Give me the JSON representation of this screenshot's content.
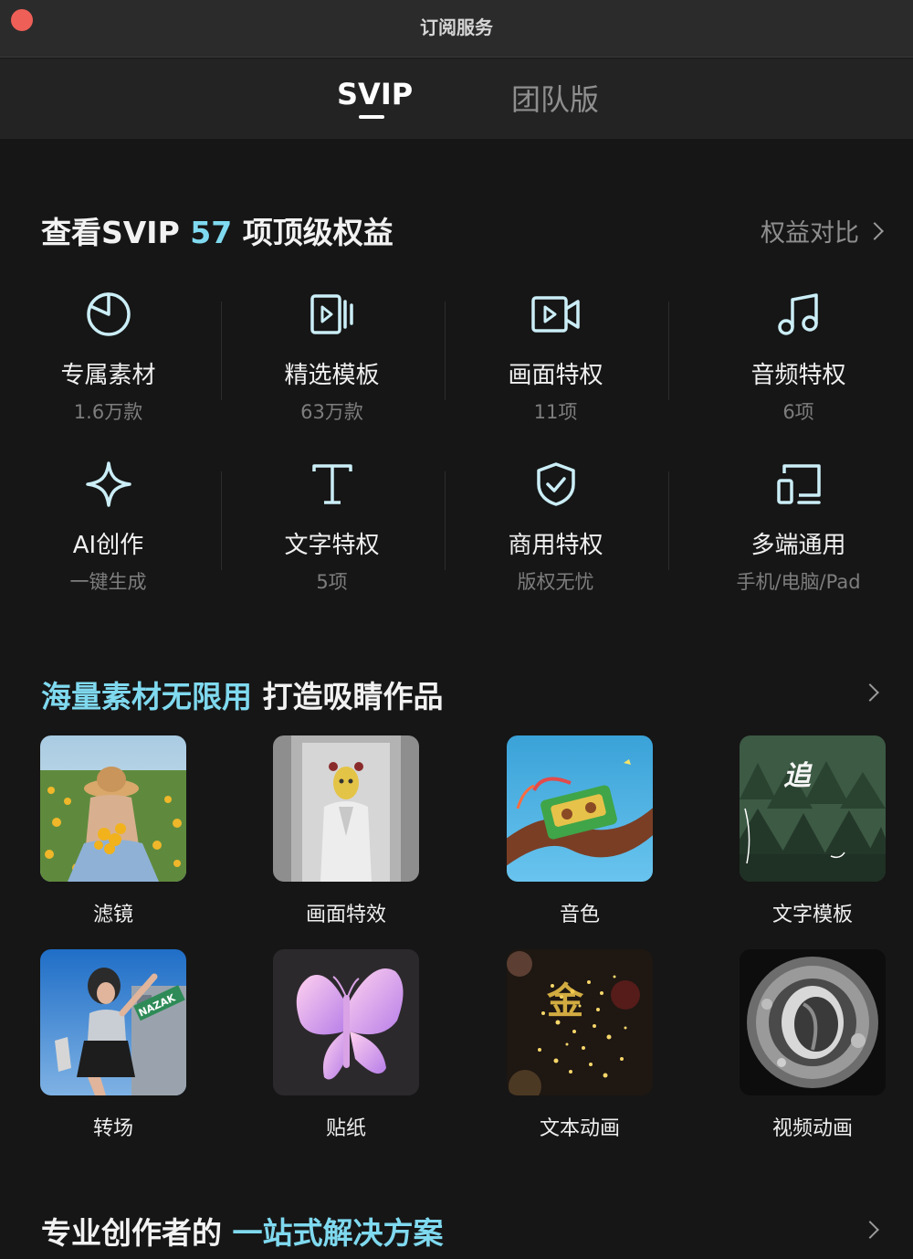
{
  "window": {
    "title": "订阅服务"
  },
  "tabs": [
    {
      "label": "SVIP",
      "active": true
    },
    {
      "label": "团队版",
      "active": false
    }
  ],
  "benefits_section": {
    "title_prefix": "查看SVIP ",
    "count": "57",
    "title_suffix": " 项顶级权益",
    "compare_link": "权益对比"
  },
  "benefits": [
    {
      "name": "专属素材",
      "sub": "1.6万款",
      "icon": "pie-icon"
    },
    {
      "name": "精选模板",
      "sub": "63万款",
      "icon": "template-icon"
    },
    {
      "name": "画面特权",
      "sub": "11项",
      "icon": "video-icon"
    },
    {
      "name": "音频特权",
      "sub": "6项",
      "icon": "music-note-icon"
    },
    {
      "name": "AI创作",
      "sub": "一键生成",
      "icon": "sparkle-icon"
    },
    {
      "name": "文字特权",
      "sub": "5项",
      "icon": "text-icon"
    },
    {
      "name": "商用特权",
      "sub": "版权无忧",
      "icon": "shield-check-icon"
    },
    {
      "name": "多端通用",
      "sub": "手机/电脑/Pad",
      "icon": "devices-icon"
    }
  ],
  "materials_section": {
    "title_accent": "海量素材无限用",
    "title_rest": " 打造吸睛作品"
  },
  "materials": [
    {
      "label": "滤镜"
    },
    {
      "label": "画面特效"
    },
    {
      "label": "音色"
    },
    {
      "label": "文字模板"
    },
    {
      "label": "转场"
    },
    {
      "label": "贴纸"
    },
    {
      "label": "文本动画"
    },
    {
      "label": "视频动画"
    }
  ],
  "thumb_text": {
    "text_template_char": "追",
    "transition_sign": "NAZAK",
    "text_anim_char": "金"
  },
  "solution_section": {
    "title_prefix": "专业创作者的 ",
    "title_accent": "一站式解决方案"
  },
  "colors": {
    "accent": "#7fd9ef",
    "background": "#161616",
    "close_button": "#ee5f57"
  }
}
